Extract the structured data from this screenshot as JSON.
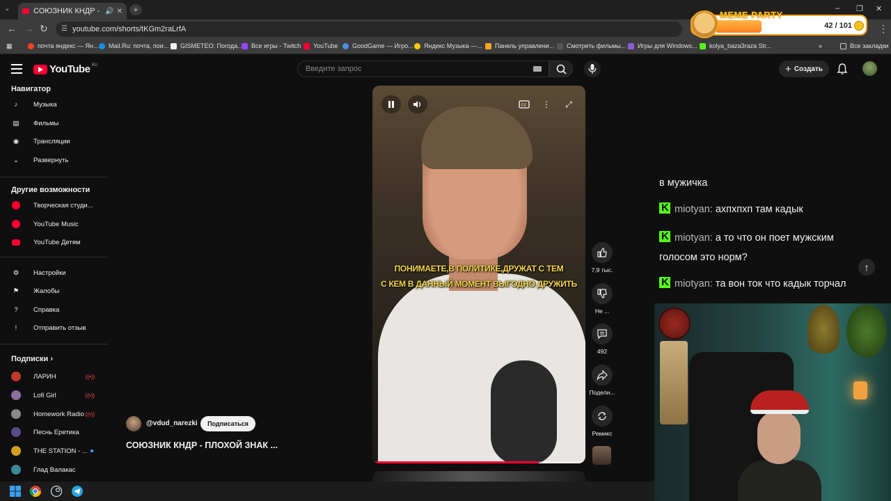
{
  "browser": {
    "tab_title": "СОЮЗНИК КНДР - ПЛОХО",
    "url": "youtube.com/shorts/tKGm2raLrfA",
    "bookmarks": [
      "почта яндекс — Ян...",
      "Mail.Ru: почта, пои...",
      "GISMETEO: Погода...",
      "Все игры - Twitch",
      "YouTube",
      "GoodGame — Игро...",
      "Яндекс Музыка —...",
      "Панель управлени...",
      "Смотреть фильмы...",
      "Игры для Windows...",
      "kolya_baza3raza Str..."
    ],
    "all_bookmarks": "Все закладки",
    "colors": {
      "tab_bg": "#3c3c3c",
      "chrome_bg": "#1f1f1f"
    }
  },
  "overlay": {
    "brand": "MEME PARTY",
    "progress": "42 / 101"
  },
  "header": {
    "logo": "YouTube",
    "logo_region": "RU",
    "search_placeholder": "Введите запрос",
    "create_label": "Создать"
  },
  "sidebar": {
    "navigator_title": "Навигатор",
    "navigator": [
      {
        "label": "Музыка",
        "icon": "music-note-icon"
      },
      {
        "label": "Фильмы",
        "icon": "film-icon"
      },
      {
        "label": "Трансляции",
        "icon": "broadcast-icon"
      },
      {
        "label": "Развернуть",
        "icon": "chevron-down-icon"
      }
    ],
    "more_title": "Другие возможности",
    "more": [
      {
        "label": "Творческая студи...",
        "icon": "studio-icon"
      },
      {
        "label": "YouTube Music",
        "icon": "yt-music-icon"
      },
      {
        "label": "YouTube Детям",
        "icon": "yt-kids-icon"
      }
    ],
    "settings": [
      {
        "label": "Настройки",
        "icon": "gear-icon"
      },
      {
        "label": "Жалобы",
        "icon": "flag-icon"
      },
      {
        "label": "Справка",
        "icon": "help-icon"
      },
      {
        "label": "Отправить отзыв",
        "icon": "feedback-icon"
      }
    ],
    "subs_title": "Подписки",
    "subscriptions": [
      {
        "label": "ЛАРИН",
        "live": true,
        "color": "#c0392b"
      },
      {
        "label": "Lofi Girl",
        "live": true,
        "color": "#8e6e9e"
      },
      {
        "label": "Homework Radio",
        "live": true,
        "color": "#888888"
      },
      {
        "label": "Песнь Еретика",
        "live": false,
        "color": "#5b4a8a"
      },
      {
        "label": "THE STATION - ...",
        "live": false,
        "dot": true,
        "color": "#d4a020"
      },
      {
        "label": "Глад Валакас",
        "live": false,
        "color": "#3a8a9a"
      }
    ]
  },
  "video": {
    "subtitle_line1": "ПОНИМАЕТЕ,В ПОЛИТИКЕ,ДРУЖАТ С ТЕМ",
    "subtitle_line2": "С КЕМ В ДАННЫЙ МОМЕНТ ВЫГОДНО ДРУЖИТЬ",
    "progress_fraction": 0.78,
    "channel": "@vdud_narezki",
    "subscribe_label": "Подписаться",
    "title": "СОЮЗНИК КНДР - ПЛОХОЙ ЗНАК ..."
  },
  "actions": {
    "likes": "7,9 тыс.",
    "dislike_label": "Не ...",
    "comments": "492",
    "share_label": "Подели...",
    "remix_label": "Ремикс"
  },
  "chat": {
    "fragment": "в мужичка",
    "messages": [
      {
        "user": "miotyan:",
        "text": "ахпхпхп там кадык"
      },
      {
        "user": "miotyan:",
        "text": "а то что он поет мужским",
        "text2": "голосом это норм?"
      },
      {
        "user": "miotyan:",
        "text": "та вон ток что кадык торчал"
      }
    ]
  }
}
